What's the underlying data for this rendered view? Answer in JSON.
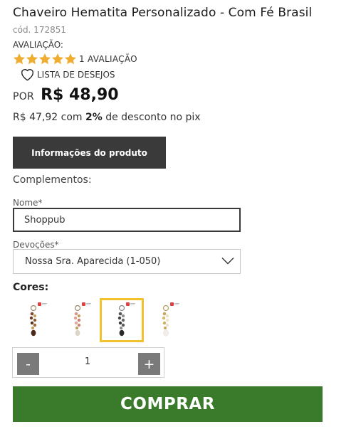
{
  "product": {
    "title": "Chaveiro Hematita Personalizado - Com Fé Brasil",
    "code": "cód. 172851",
    "rating_label": "AVALIAÇÃO:",
    "rating_stars": 5,
    "rating_count": "1 AVALIAÇÃO",
    "wishlist_label": "LISTA DE DESEJOS",
    "price_prefix": "POR",
    "price": "R$ 48,90",
    "pix_price": "R$ 47,92",
    "pix_mid": " com ",
    "pix_percent": "2%",
    "pix_suffix": " de desconto no pix"
  },
  "info_button": "Informações do produto",
  "complementos_label": "Complementos:",
  "form": {
    "nome_label": "Nome*",
    "nome_value": "Shoppub",
    "devocoes_label": "Devoções*",
    "devocoes_value": "Nossa Sra. Aparecida (1-050)"
  },
  "cores": {
    "label": "Cores:",
    "options": [
      "brown-beads",
      "pink-beads",
      "black-hematite",
      "white-beads"
    ],
    "selected": "black-hematite"
  },
  "quantity": {
    "minus": "-",
    "value": "1",
    "plus": "+"
  },
  "buy_button": "COMPRAR",
  "colors": {
    "star": "#f0ad32",
    "dark_button": "#3a3a3a",
    "buy_green": "#3a7a2b",
    "selected_border": "#f2c12e"
  }
}
